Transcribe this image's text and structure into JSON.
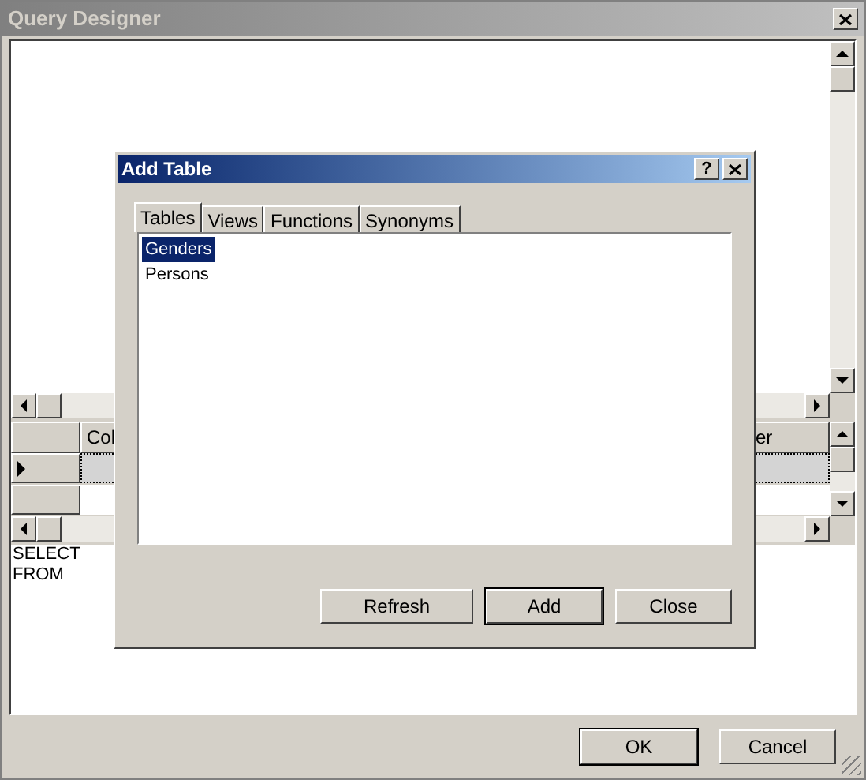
{
  "window": {
    "title": "Query Designer"
  },
  "grid": {
    "columns": [
      {
        "label": "Col"
      },
      {
        "label": "er"
      }
    ],
    "rows": [
      {
        "selected": true
      },
      {
        "selected": false
      }
    ]
  },
  "sql": {
    "lines": [
      "SELECT",
      "FROM"
    ]
  },
  "buttons": [
    {
      "label": "OK",
      "default": true
    },
    {
      "label": "Cancel",
      "default": false
    }
  ],
  "dialog": {
    "title": "Add Table",
    "help": "?",
    "tabs": [
      {
        "label": "Tables",
        "selected": true
      },
      {
        "label": "Views",
        "selected": false
      },
      {
        "label": "Functions",
        "selected": false
      },
      {
        "label": "Synonyms",
        "selected": false
      }
    ],
    "items": [
      {
        "label": "Genders",
        "selected": true
      },
      {
        "label": "Persons",
        "selected": false
      }
    ],
    "buttons": [
      {
        "label": "Refresh",
        "default": false
      },
      {
        "label": "Add",
        "default": true
      },
      {
        "label": "Close",
        "default": false
      }
    ]
  }
}
